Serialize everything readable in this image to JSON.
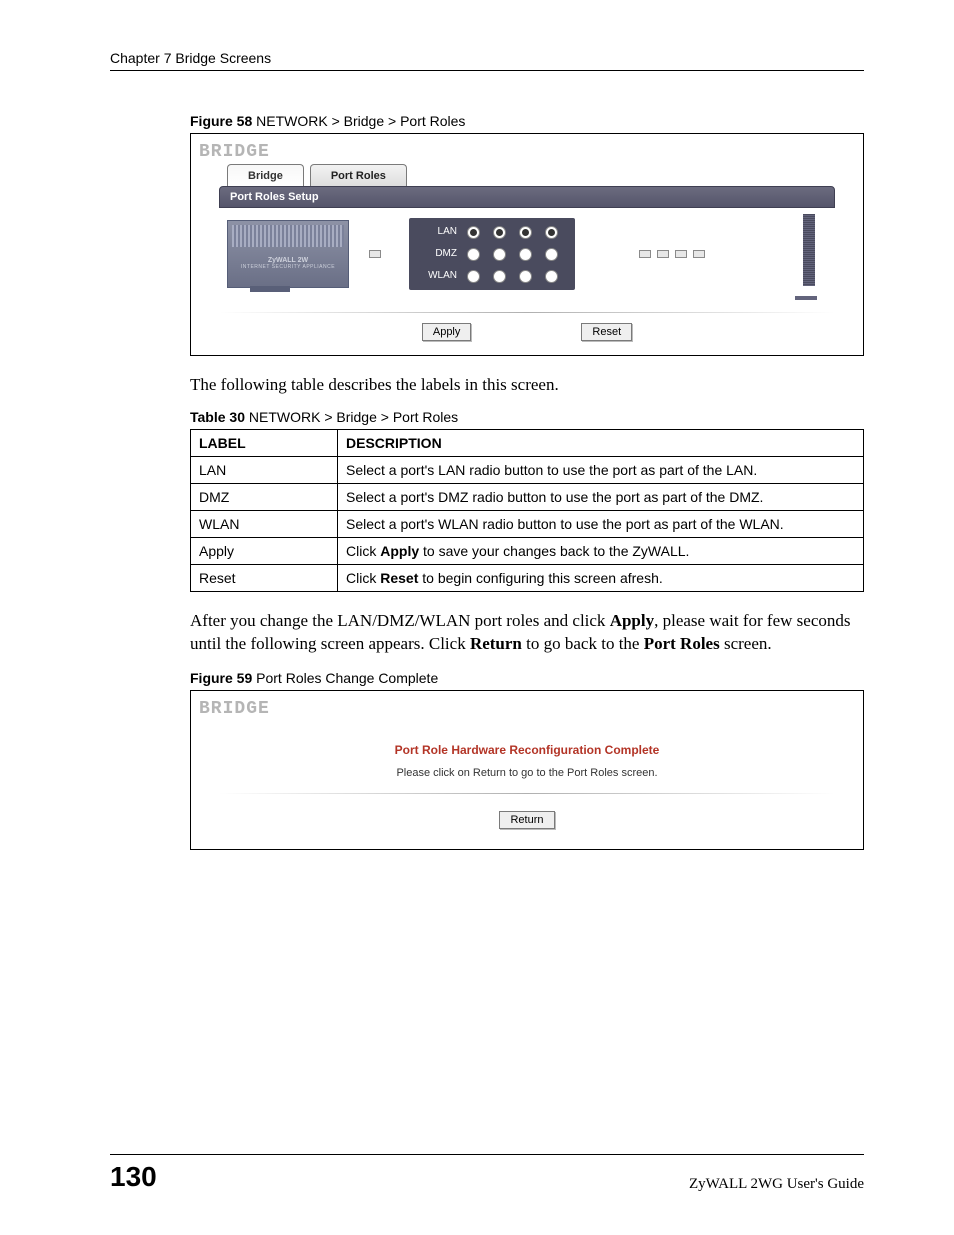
{
  "header": {
    "chapter": "Chapter 7 Bridge Screens"
  },
  "fig58": {
    "caption_bold": "Figure 58",
    "caption_rest": "   NETWORK > Bridge > Port Roles",
    "bridge_title": "BRIDGE",
    "tabs": {
      "bridge": "Bridge",
      "port_roles": "Port Roles"
    },
    "section_bar": "Port Roles Setup",
    "device": {
      "l1": "ZyWALL 2W",
      "l2": "INTERNET SECURITY APPLIANCE"
    },
    "rows": {
      "lan": "LAN",
      "dmz": "DMZ",
      "wlan": "WLAN"
    },
    "buttons": {
      "apply": "Apply",
      "reset": "Reset"
    }
  },
  "intro_para": "The following table describes the labels in this screen.",
  "table30": {
    "caption_bold": "Table 30",
    "caption_rest": "   NETWORK > Bridge > Port Roles",
    "head": {
      "label": "LABEL",
      "desc": "DESCRIPTION"
    },
    "rows": [
      {
        "label": "LAN",
        "desc": "Select a port's LAN radio button to use the port as part of the LAN."
      },
      {
        "label": "DMZ",
        "desc": "Select a port's DMZ radio button to use the port as part of the DMZ."
      },
      {
        "label": "WLAN",
        "desc": "Select a port's WLAN radio button to use the port as part of the WLAN."
      },
      {
        "label": "Apply",
        "desc_pre": "Click ",
        "desc_bold": "Apply",
        "desc_post": " to save your changes back to the ZyWALL."
      },
      {
        "label": "Reset",
        "desc_pre": "Click ",
        "desc_bold": "Reset",
        "desc_post": " to begin configuring this screen afresh."
      }
    ]
  },
  "after_para": {
    "t1": "After you change the LAN/DMZ/WLAN port roles and click ",
    "b1": "Apply",
    "t2": ", please wait for few seconds until the following screen appears. Click ",
    "b2": "Return",
    "t3": " to go back to the ",
    "b3": "Port Roles",
    "t4": " screen."
  },
  "fig59": {
    "caption_bold": "Figure 59",
    "caption_rest": "   Port Roles Change Complete",
    "bridge_title": "BRIDGE",
    "msg_title": "Port Role Hardware Reconfiguration Complete",
    "msg_sub": "Please click on Return to go to the Port Roles screen.",
    "button": "Return"
  },
  "footer": {
    "page": "130",
    "guide": "ZyWALL 2WG User's Guide"
  }
}
